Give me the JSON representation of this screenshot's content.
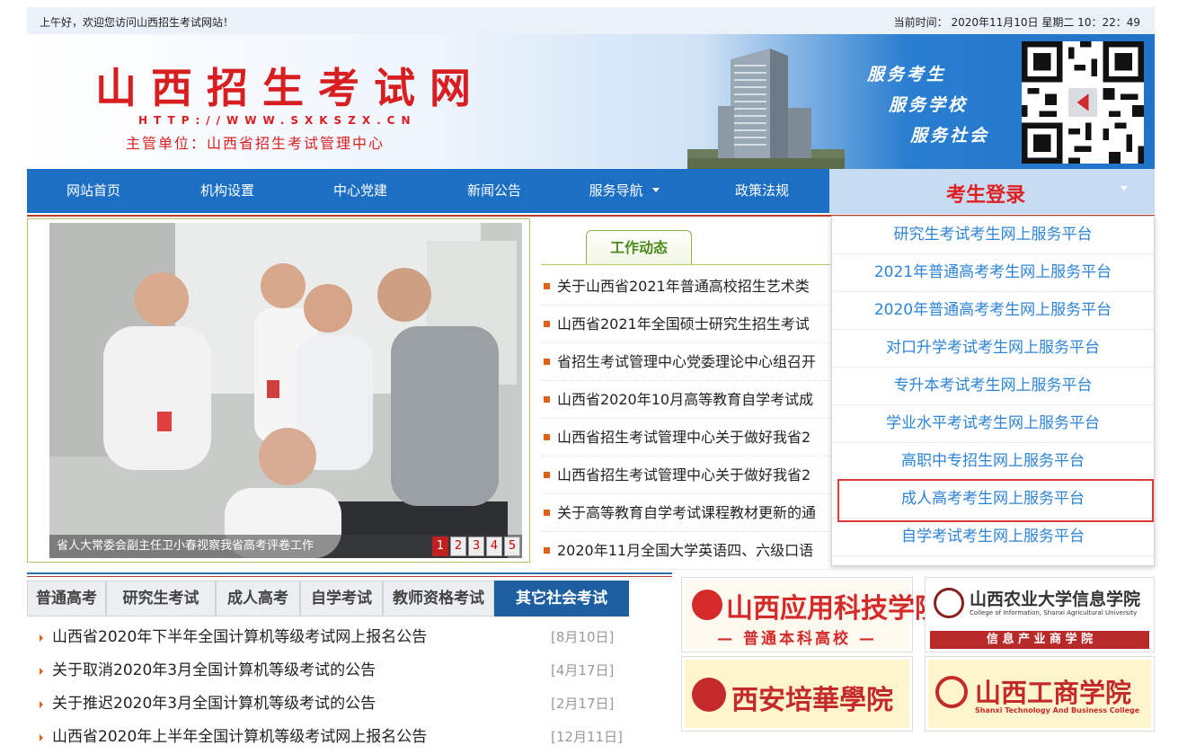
{
  "topbar": {
    "greeting": "上午好，欢迎您访问山西招生考试网站！",
    "clock": "当前时间： 2020年11月10日 星期二 10：22：49"
  },
  "banner": {
    "title": "山西招生考试网",
    "url": "HTTP://WWW.SXKSZX.CN",
    "subtitle": "主管单位：山西省招生考试管理中心",
    "slogans": [
      "服务考生",
      "服务学校",
      "服务社会"
    ]
  },
  "nav": {
    "items": [
      "网站首页",
      "机构设置",
      "中心党建",
      "新闻公告",
      "服务导航",
      "政策法规"
    ],
    "login": "考生登录"
  },
  "slideshow": {
    "caption": "省人大常委会副主任卫小春视察我省高考评卷工作",
    "pages": [
      "1",
      "2",
      "3",
      "4",
      "5"
    ]
  },
  "news": {
    "tab": "工作动态",
    "items": [
      "关于山西省2021年普通高校招生艺术类",
      "山西省2021年全国硕士研究生招生考试",
      "省招生考试管理中心党委理论中心组召开",
      "山西省2020年10月高等教育自学考试成",
      "山西省招生考试管理中心关于做好我省2",
      "山西省招生考试管理中心关于做好我省2",
      "关于高等教育自学考试课程教材更新的通",
      "2020年11月全国大学英语四、六级口语"
    ]
  },
  "dropdown": {
    "items": [
      "研究生考试考生网上服务平台",
      "2021年普通高考考生网上服务平台",
      "2020年普通高考考生网上服务平台",
      "对口升学考试考生网上服务平台",
      "专升本考试考生网上服务平台",
      "学业水平考试考生网上服务平台",
      "高职中专招生网上服务平台",
      "成人高考考生网上服务平台",
      "自学考试考生网上服务平台"
    ]
  },
  "exam_tabs": [
    "普通高考",
    "研究生考试",
    "成人高考",
    "自学考试",
    "教师资格考试",
    "其它社会考试"
  ],
  "exam_list": [
    {
      "title": "山西省2020年下半年全国计算机等级考试网上报名公告",
      "date": "[8月10日]"
    },
    {
      "title": "关于取消2020年3月全国计算机等级考试的公告",
      "date": "[4月17日]"
    },
    {
      "title": "关于推迟2020年3月全国计算机等级考试的公告",
      "date": "[2月17日]"
    },
    {
      "title": "山西省2020年上半年全国计算机等级考试网上报名公告",
      "date": "[12月11日]"
    }
  ],
  "ads": {
    "a1": {
      "name": "山西应用科技学院",
      "sub": "— 普通本科高校 —"
    },
    "a2": {
      "name": "山西农业大学信息学院",
      "en": "College of Information, Shanxi Agricultural University",
      "sub": "信 息 产 业 商 学 院"
    },
    "a3": {
      "name": "西安培華學院"
    },
    "a4": {
      "name": "山西工商学院",
      "en": "Shanxi Technology And Business College"
    }
  },
  "colors": {
    "nav_blue": "#1d6fc3",
    "brand_red": "#d81e20",
    "link_blue": "#2e84d4",
    "highlight": "#e0393b"
  }
}
